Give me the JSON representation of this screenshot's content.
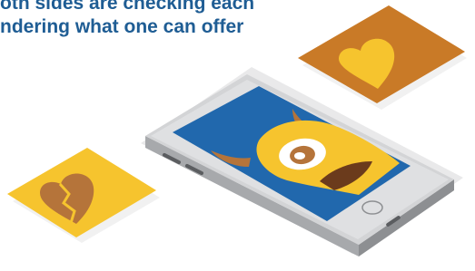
{
  "headline": {
    "line1": "oth sides are checking each",
    "line2": "ndering what one can offer"
  },
  "colors": {
    "headline": "#1f5d94",
    "card_orange": "#c97a27",
    "card_yellow": "#f6c42e",
    "heart_yellow": "#f6c42e",
    "heart_brown": "#b5743a",
    "screen_blue": "#2168ad",
    "monster_yellow": "#f6c42e",
    "horn_brown": "#b5743a",
    "phone_silver": "#cfd0d2"
  },
  "illustration": {
    "icons": [
      "phone-icon",
      "heart-icon",
      "broken-heart-icon",
      "monster-icon"
    ]
  }
}
